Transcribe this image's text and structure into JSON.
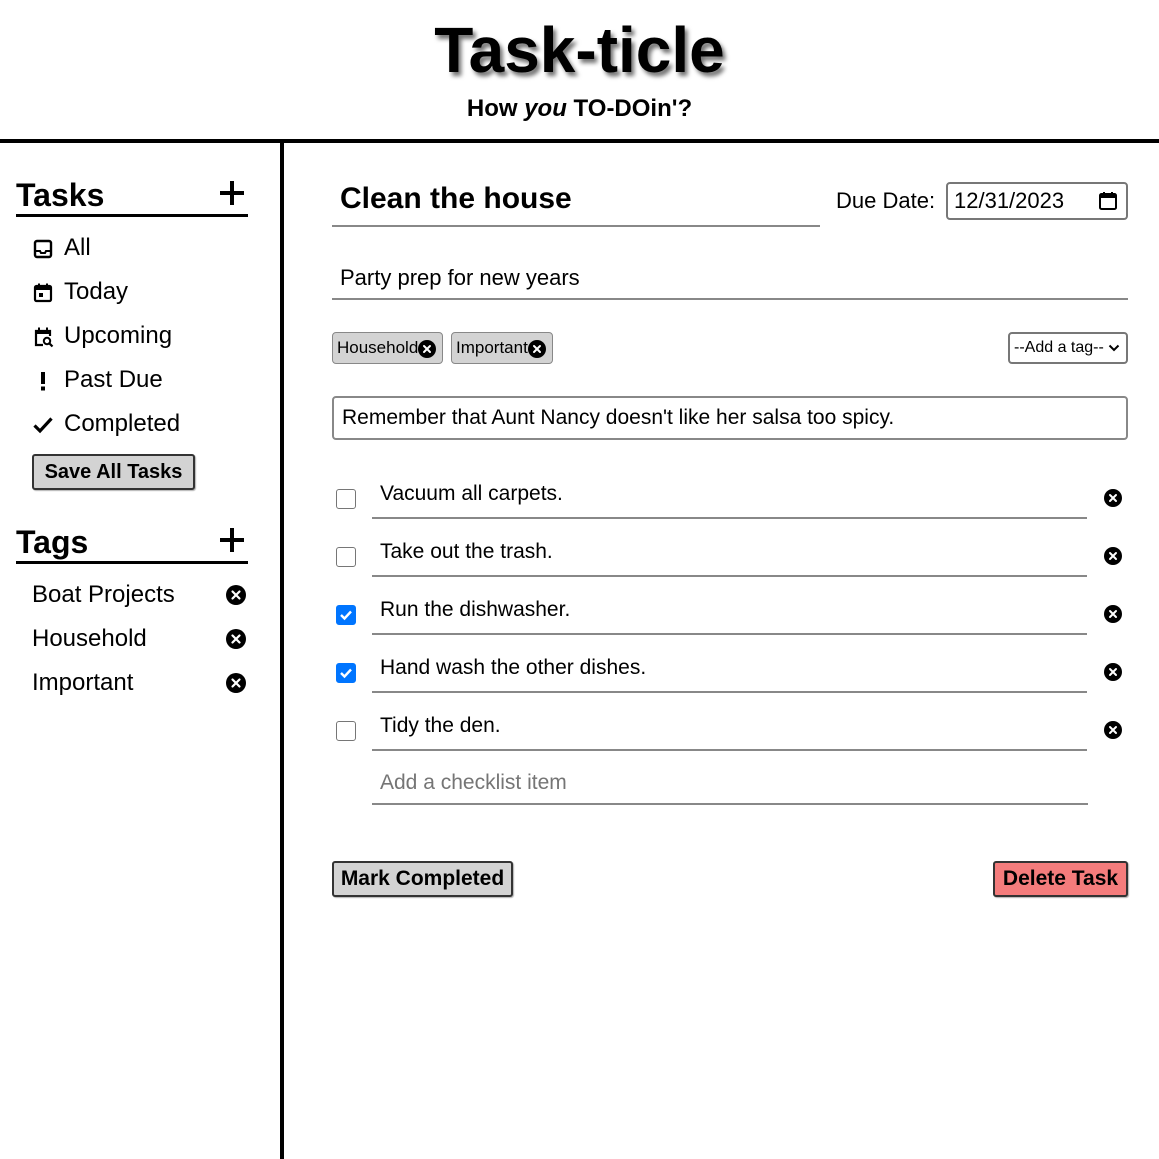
{
  "header": {
    "title": "Task-ticle",
    "subtitle_before": "How ",
    "subtitle_em": "you",
    "subtitle_after": " TO-DOin'?"
  },
  "sidebar": {
    "tasks_heading": "Tasks",
    "nav": [
      {
        "label": "All",
        "icon": "inbox-icon"
      },
      {
        "label": "Today",
        "icon": "calendar-today-icon"
      },
      {
        "label": "Upcoming",
        "icon": "calendar-search-icon"
      },
      {
        "label": "Past Due",
        "icon": "exclamation-icon"
      },
      {
        "label": "Completed",
        "icon": "checkmark-icon"
      }
    ],
    "save_label": "Save All Tasks",
    "tags_heading": "Tags",
    "tags": [
      "Boat Projects",
      "Household",
      "Important"
    ]
  },
  "task": {
    "title": "Clean the house",
    "due_label": "Due Date:",
    "due_value": "12/31/2023",
    "subtitle": "Party prep for new years",
    "tags": [
      "Household",
      "Important"
    ],
    "add_tag_option": "--Add a tag--",
    "notes": "Remember that Aunt Nancy doesn't like her salsa too spicy.",
    "checklist": [
      {
        "text": "Vacuum all carpets.",
        "checked": false
      },
      {
        "text": "Take out the trash.",
        "checked": false
      },
      {
        "text": "Run the dishwasher.",
        "checked": true
      },
      {
        "text": "Hand wash the other dishes.",
        "checked": true
      },
      {
        "text": "Tidy the den.",
        "checked": false
      }
    ],
    "add_item_placeholder": "Add a checklist item",
    "mark_completed_label": "Mark Completed",
    "delete_label": "Delete Task"
  },
  "colors": {
    "checkbox_checked": "#0075ff",
    "delete_button": "#f47c7c",
    "neutral_button": "#d3d3d3"
  }
}
